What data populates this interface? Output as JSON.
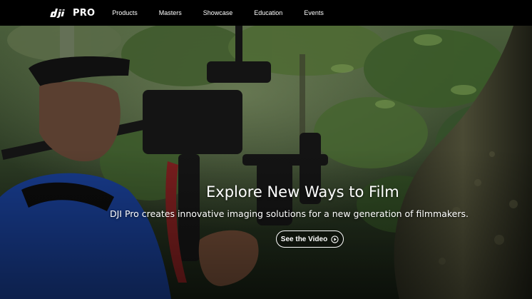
{
  "header": {
    "brand_text": "PRO",
    "logo_icon": "dji-logo-icon",
    "nav": [
      {
        "label": "Products"
      },
      {
        "label": "Masters"
      },
      {
        "label": "Showcase"
      },
      {
        "label": "Education"
      },
      {
        "label": "Events"
      }
    ]
  },
  "hero": {
    "title": "Explore New Ways to Film",
    "subtitle": "DJI Pro creates innovative imaging solutions for a new generation of filmmakers.",
    "button_label": "See the Video",
    "button_icon": "play-circle-icon"
  },
  "colors": {
    "header_bg": "#000000",
    "text": "#ffffff",
    "foliage": "#3f5a2c"
  }
}
